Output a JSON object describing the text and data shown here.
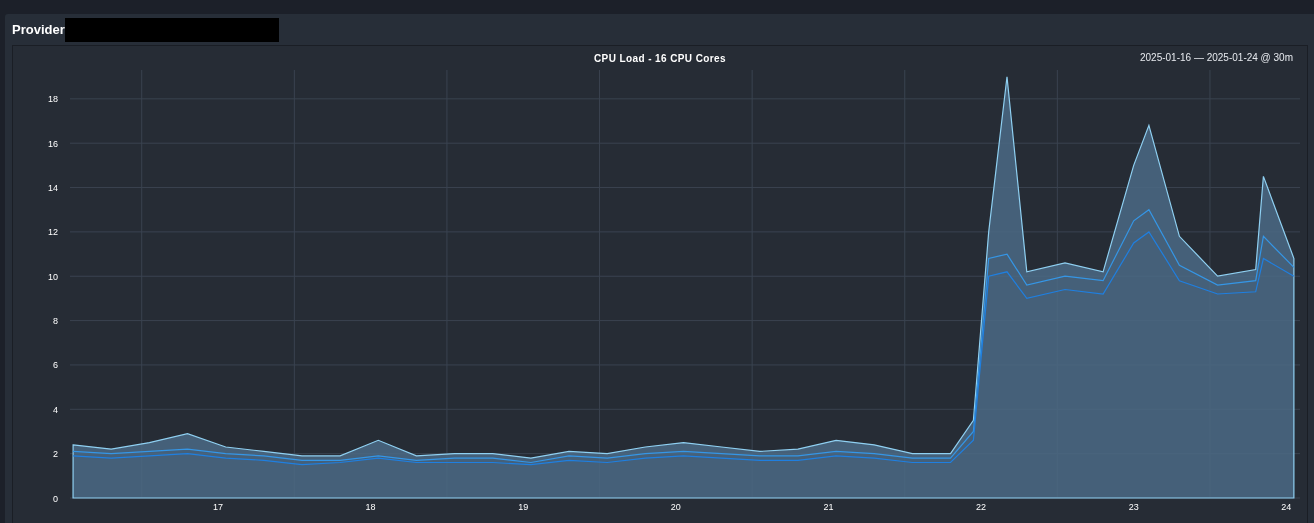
{
  "panel": {
    "title": "Provider"
  },
  "chart": {
    "range": "2025-01-16 — 2025-01-24 @ 30m",
    "chart_data": {
      "type": "area",
      "title": "CPU Load - 16 CPU Cores",
      "xlim": [
        16.03,
        24.09
      ],
      "ylim": [
        0,
        19.3
      ],
      "grid": true,
      "xticks": [
        17,
        18,
        19,
        20,
        21,
        22,
        23,
        24
      ],
      "yticks": [
        0,
        2,
        4,
        6,
        8,
        10,
        12,
        14,
        16,
        18
      ],
      "x": [
        16.05,
        16.3,
        16.55,
        16.8,
        17.05,
        17.3,
        17.55,
        17.8,
        18.05,
        18.3,
        18.55,
        18.8,
        19.05,
        19.3,
        19.55,
        19.8,
        20.05,
        20.3,
        20.55,
        20.8,
        21.05,
        21.3,
        21.55,
        21.8,
        21.95,
        22.05,
        22.17,
        22.3,
        22.55,
        22.8,
        23.0,
        23.1,
        23.3,
        23.55,
        23.8,
        23.85,
        24.05
      ],
      "series": [
        {
          "type": "area",
          "color": "#8fd0f2",
          "values": [
            2.4,
            2.2,
            2.5,
            2.9,
            2.3,
            2.1,
            1.9,
            1.9,
            2.6,
            1.9,
            2.0,
            2.0,
            1.8,
            2.1,
            2.0,
            2.3,
            2.5,
            2.3,
            2.1,
            2.2,
            2.6,
            2.4,
            2.0,
            2.0,
            3.5,
            12.0,
            19.0,
            10.2,
            10.6,
            10.2,
            15.0,
            16.8,
            11.8,
            10.0,
            10.3,
            14.5,
            10.8
          ]
        },
        {
          "type": "line",
          "color": "#3596e6",
          "values": [
            2.1,
            2.0,
            2.1,
            2.2,
            2.0,
            1.9,
            1.7,
            1.7,
            1.9,
            1.7,
            1.8,
            1.8,
            1.6,
            1.9,
            1.8,
            2.0,
            2.1,
            2.0,
            1.9,
            1.9,
            2.1,
            2.0,
            1.8,
            1.8,
            3.0,
            10.8,
            11.0,
            9.6,
            10.0,
            9.8,
            12.5,
            13.0,
            10.5,
            9.6,
            9.8,
            11.8,
            10.4
          ]
        },
        {
          "type": "line",
          "color": "#1f7fe0",
          "values": [
            1.9,
            1.8,
            1.9,
            2.0,
            1.8,
            1.7,
            1.5,
            1.6,
            1.8,
            1.6,
            1.6,
            1.6,
            1.5,
            1.7,
            1.6,
            1.8,
            1.9,
            1.8,
            1.7,
            1.7,
            1.9,
            1.8,
            1.6,
            1.6,
            2.6,
            10.0,
            10.2,
            9.0,
            9.4,
            9.2,
            11.5,
            12.0,
            9.8,
            9.2,
            9.3,
            10.8,
            10.0
          ]
        }
      ]
    }
  }
}
